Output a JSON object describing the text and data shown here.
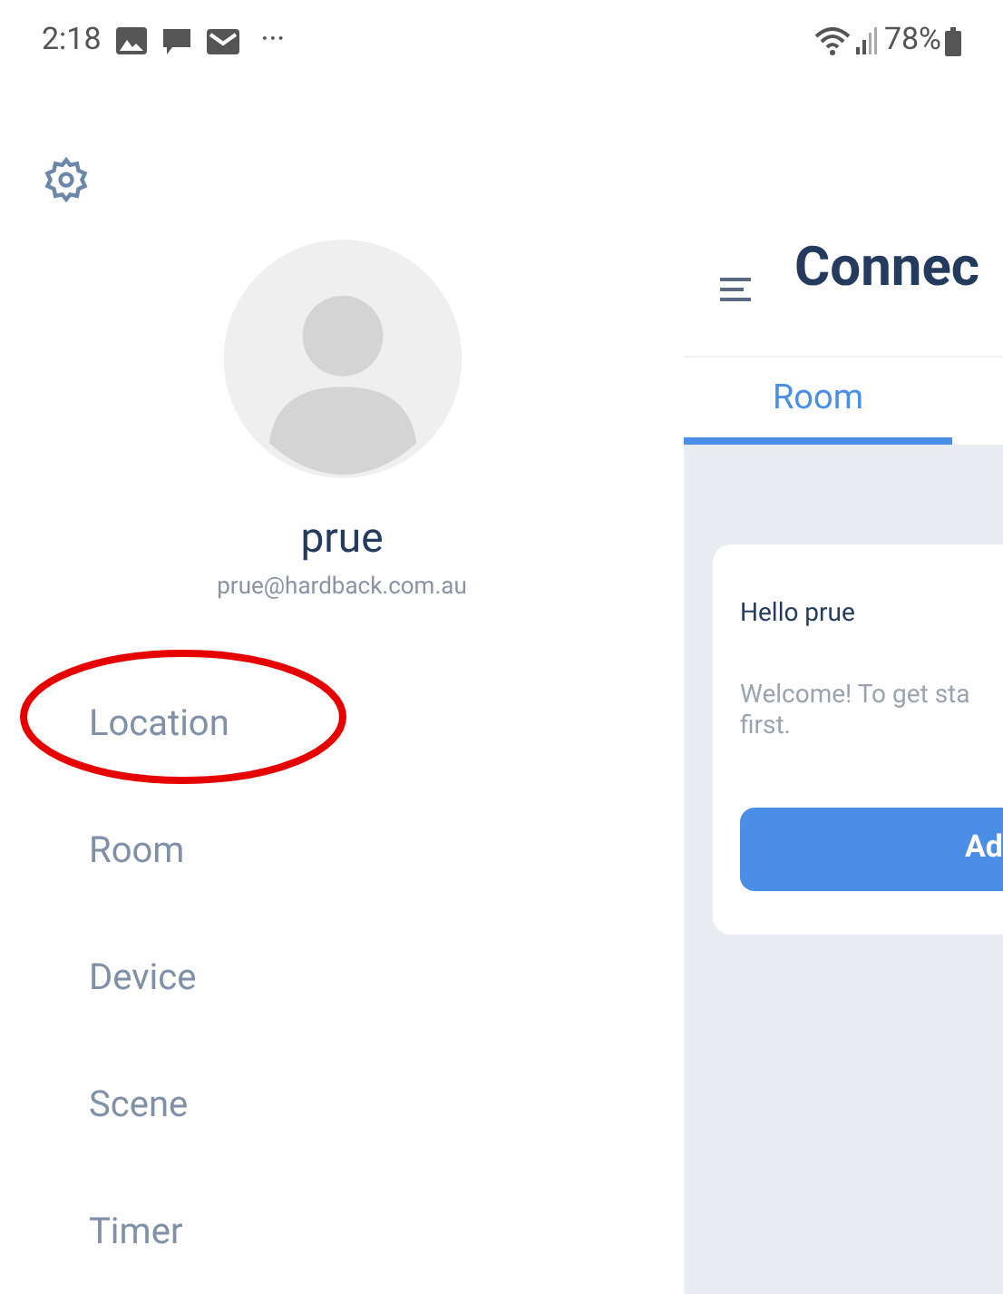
{
  "status_bar": {
    "time": "2:18",
    "more": "···",
    "battery": "78%"
  },
  "drawer": {
    "user_name": "prue",
    "email": "prue@hardback.com.au",
    "items": [
      {
        "label": "Location",
        "circled": true
      },
      {
        "label": "Room",
        "circled": false
      },
      {
        "label": "Device",
        "circled": false
      },
      {
        "label": "Scene",
        "circled": false
      },
      {
        "label": "Timer",
        "circled": false
      }
    ]
  },
  "main": {
    "title": "Connec",
    "tabs": [
      {
        "label": "Room",
        "selected": true
      }
    ],
    "card": {
      "greeting": "Hello prue",
      "message_lines": [
        "Welcome! To get sta",
        "first."
      ],
      "button": "Ad"
    }
  }
}
